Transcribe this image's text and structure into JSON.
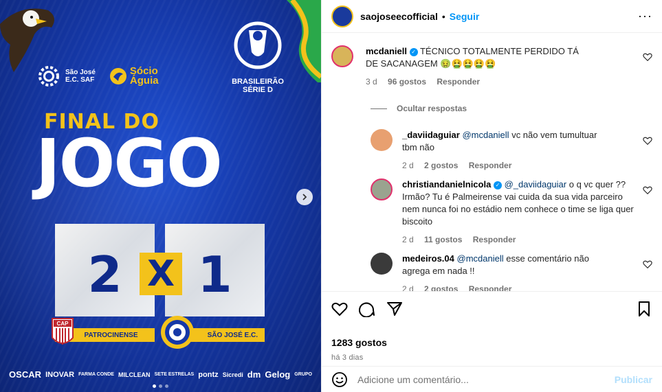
{
  "post": {
    "brand_left": "São José\nE.C. SAF",
    "brand_socio": "Sócio\nÁguia",
    "league": "BRASILEIRÃO\nSÉRIE D",
    "headline_small": "FINAL DO",
    "headline_big": "JOGO",
    "home_score": "2",
    "separator": "X",
    "away_score": "1",
    "home_team": "PATROCINENSE",
    "away_team": "SÃO JOSÉ E.C.",
    "home_badge_text": "CAP",
    "sponsors": [
      "OSCAR",
      "INOVAR",
      "FARMA CONDE",
      "MILCLEAN",
      "SETE ESTRELAS",
      "pontz",
      "Sicredi",
      "dm",
      "Gelog",
      "GRUPO"
    ]
  },
  "header": {
    "username": "saojoseecofficial",
    "follow_label": "Seguir",
    "more": "···"
  },
  "comments": [
    {
      "user": "mcdaniell",
      "verified": true,
      "text": "TÉCNICO TOTALMENTE PERDIDO TÁ DE SACANAGEM 🤢🤮🤮🤮🤮",
      "time": "3 d",
      "likes": "96 gostos",
      "reply": "Responder"
    },
    {
      "user": "_daviidaguiar",
      "verified": false,
      "mention": "@mcdaniell",
      "text": "vc não vem tumultuar tbm não",
      "time": "2 d",
      "likes": "2 gostos",
      "reply": "Responder"
    },
    {
      "user": "christiandanielnicola",
      "verified": true,
      "mention": "@_daviidaguiar",
      "text": "o q vc quer ?? Irmão? Tu é Palmeirense vai cuida da sua vida parceiro nem nunca foi no estádio nem conhece o time se liga quer biscoito",
      "time": "2 d",
      "likes": "11 gostos",
      "reply": "Responder"
    },
    {
      "user": "medeiros.04",
      "verified": false,
      "mention": "@mcdaniell",
      "text": "esse comentário não agrega em nada !!",
      "time": "2 d",
      "likes": "2 gostos",
      "reply": "Responder"
    }
  ],
  "hide_replies": "Ocultar respostas",
  "footer": {
    "likes": "1283 gostos",
    "time": "há 3 dias",
    "comment_placeholder": "Adicione um comentário...",
    "publish": "Publicar"
  },
  "colors": {
    "brand_blue": "#1538a8",
    "brand_yellow": "#f3c21b",
    "link_blue": "#0095f6"
  }
}
